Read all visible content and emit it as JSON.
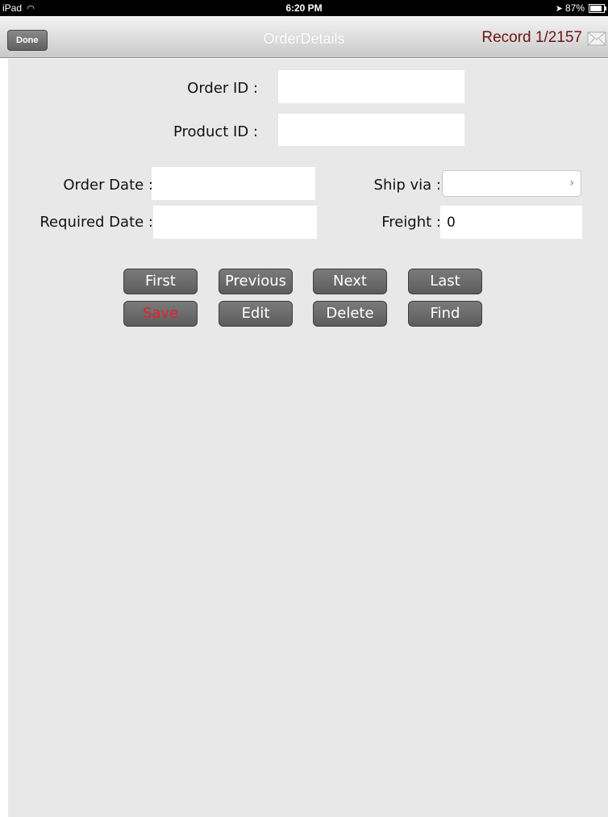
{
  "status_bar": {
    "device": "iPad",
    "time": "6:20 PM",
    "battery": "87%"
  },
  "nav": {
    "done_label": "Done",
    "title": "OrderDetails",
    "record": "Record 1/2157"
  },
  "form": {
    "order_id_label": "Order ID :",
    "order_id_value": "",
    "product_id_label": "Product ID :",
    "product_id_value": "",
    "order_date_label": "Order Date :",
    "order_date_value": "",
    "required_date_label": "Required Date :",
    "required_date_value": "",
    "ship_via_label": "Ship via :",
    "ship_via_value": "",
    "freight_label": "Freight :",
    "freight_value": "0"
  },
  "buttons": {
    "first": "First",
    "previous": "Previous",
    "next": "Next",
    "last": "Last",
    "save": "Save",
    "edit": "Edit",
    "delete": "Delete",
    "find": "Find"
  },
  "colors": {
    "save_text": "#e3232a",
    "record_text": "#6e1414",
    "content_bg": "#e8e8e8"
  }
}
